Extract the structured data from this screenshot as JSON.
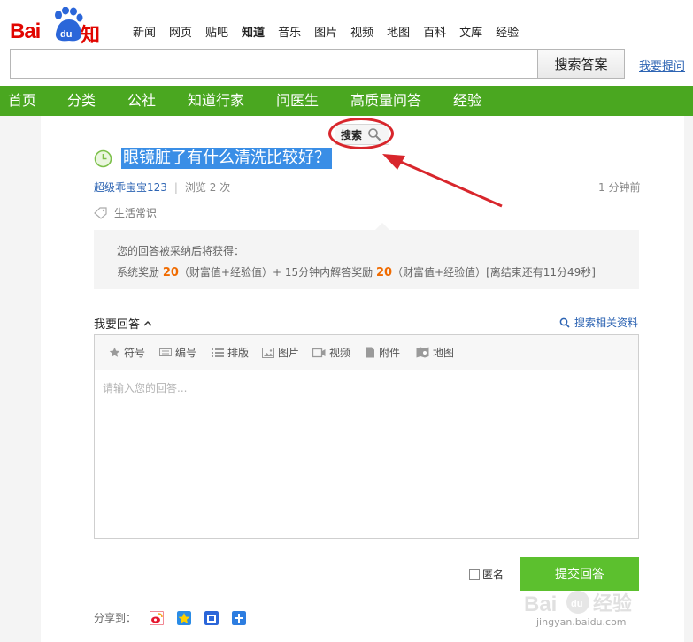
{
  "logo": {
    "bai": "Bai",
    "du": "du",
    "zhidao": "知道"
  },
  "topnav": [
    "新闻",
    "网页",
    "贴吧",
    "知道",
    "音乐",
    "图片",
    "视频",
    "地图",
    "百科",
    "文库",
    "经验"
  ],
  "search": {
    "button": "搜索答案",
    "ask_link": "我要提问",
    "value": ""
  },
  "greennav": [
    "首页",
    "分类",
    "公社",
    "知道行家",
    "问医生",
    "高质量问答",
    "经验"
  ],
  "float_search": {
    "label": "搜索"
  },
  "question": {
    "title": "眼镜脏了有什么清洗比较好？",
    "user": "超级乖宝宝123",
    "views": "浏览 2 次",
    "time": "1 分钟前",
    "tag": "生活常识"
  },
  "reward": {
    "line1": "您的回答被采纳后将获得：",
    "line2_prefix": "系统奖励 ",
    "line2_num1": "20",
    "line2_mid": "（财富值+经验值）+ 15分钟内解答奖励 ",
    "line2_num2": "20",
    "line2_suffix": "（财富值+经验值）[离结束还有11分49秒]"
  },
  "answer": {
    "label": "我要回答",
    "search_related": "搜索相关资料",
    "toolbar": [
      "符号",
      "编号",
      "排版",
      "图片",
      "视频",
      "附件",
      "地图"
    ],
    "placeholder": "请输入您的回答...",
    "anonymous": "匿名",
    "submit": "提交回答"
  },
  "share": {
    "label": "分享到："
  },
  "watermark": {
    "text": "jingyan.baidu.com",
    "brand": "Bai du 经验"
  },
  "colors": {
    "brand_red": "#e10601",
    "nav_green": "#4aa720",
    "submit_green": "#5cc02e",
    "link_blue": "#2d64b3",
    "highlight_orange": "#f06b00"
  }
}
